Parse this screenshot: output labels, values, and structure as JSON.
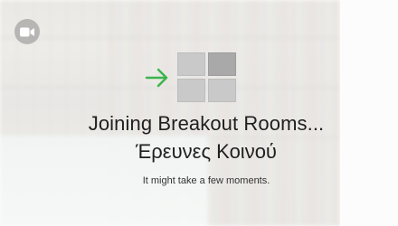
{
  "overlay": {
    "title": "Joining Breakout Rooms...",
    "room_name": "Έρευνες Κοινού",
    "subtitle": "It might take a few moments."
  },
  "icons": {
    "camera": "video-camera-icon",
    "arrow": "arrow-right-icon",
    "rooms": "breakout-rooms-grid-icon"
  },
  "colors": {
    "arrow": "#3cb44b",
    "tile": "#c9c9c9",
    "tile_dark": "#a9a9a9",
    "text": "#1f1f1f"
  }
}
